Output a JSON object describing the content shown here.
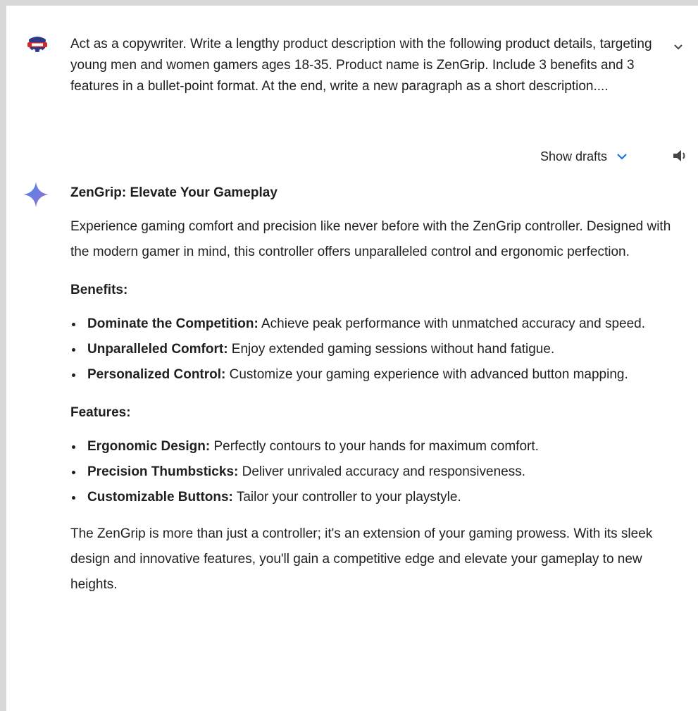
{
  "prompt": {
    "text": "Act as a copywriter. Write a lengthy product description with the following product details, targeting young men and women gamers ages 18-35. Product name is ZenGrip. Include 3 benefits and 3 features in a bullet-point format. At the end, write a new paragraph as a short description....",
    "avatar_icon": "user-avatar-icon",
    "expand_icon": "chevron-down-icon"
  },
  "toolbar": {
    "show_drafts_label": "Show drafts",
    "drafts_icon": "chevron-down-icon",
    "speaker_icon": "speaker-icon",
    "accent_color": "#1a73e8"
  },
  "response": {
    "icon": "sparkle-icon",
    "title": "ZenGrip: Elevate Your Gameplay",
    "intro": "Experience gaming comfort and precision like never before with the ZenGrip controller. Designed with the modern gamer in mind, this controller offers unparalleled control and ergonomic perfection.",
    "benefits_heading": "Benefits:",
    "benefits": [
      {
        "label": "Dominate the Competition:",
        "text": " Achieve peak performance with unmatched accuracy and speed."
      },
      {
        "label": "Unparalleled Comfort:",
        "text": " Enjoy extended gaming sessions without hand fatigue."
      },
      {
        "label": "Personalized Control:",
        "text": " Customize your gaming experience with advanced button mapping."
      }
    ],
    "features_heading": "Features:",
    "features": [
      {
        "label": "Ergonomic Design:",
        "text": " Perfectly contours to your hands for maximum comfort."
      },
      {
        "label": "Precision Thumbsticks:",
        "text": " Deliver unrivaled accuracy and responsiveness."
      },
      {
        "label": "Customizable Buttons:",
        "text": " Tailor your controller to your playstyle."
      }
    ],
    "closing": "The ZenGrip is more than just a controller; it's an extension of your gaming prowess. With its sleek design and innovative features, you'll gain a competitive edge and elevate your gameplay to new heights."
  }
}
